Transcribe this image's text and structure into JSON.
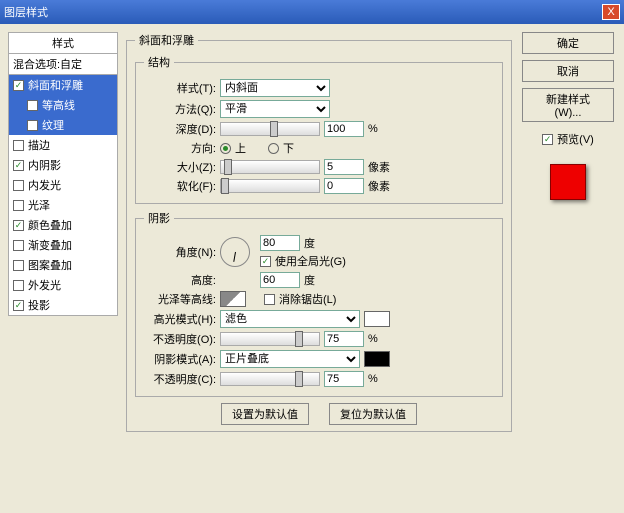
{
  "window": {
    "title": "图层样式",
    "close": "X"
  },
  "left": {
    "header": "样式",
    "sub": "混合选项:自定",
    "items": [
      {
        "label": "斜面和浮雕",
        "checked": true,
        "sel": true
      },
      {
        "label": "等高线",
        "checked": false,
        "sub": true,
        "sel": true
      },
      {
        "label": "纹理",
        "checked": false,
        "sub": true,
        "sel": true
      },
      {
        "label": "描边",
        "checked": false
      },
      {
        "label": "内阴影",
        "checked": true
      },
      {
        "label": "内发光",
        "checked": false
      },
      {
        "label": "光泽",
        "checked": false
      },
      {
        "label": "颜色叠加",
        "checked": true
      },
      {
        "label": "渐变叠加",
        "checked": false
      },
      {
        "label": "图案叠加",
        "checked": false
      },
      {
        "label": "外发光",
        "checked": false
      },
      {
        "label": "投影",
        "checked": true
      }
    ]
  },
  "bevel": {
    "group": "斜面和浮雕",
    "struct": "结构",
    "style_l": "样式(T):",
    "style_v": "内斜面",
    "tech_l": "方法(Q):",
    "tech_v": "平滑",
    "depth_l": "深度(D):",
    "depth_v": "100",
    "pct": "%",
    "dir_l": "方向:",
    "up": "上",
    "down": "下",
    "size_l": "大小(Z):",
    "size_v": "5",
    "px": "像素",
    "soften_l": "软化(F):",
    "soften_v": "0"
  },
  "shade": {
    "group": "阴影",
    "angle_l": "角度(N):",
    "angle_v": "80",
    "deg": "度",
    "global": "使用全局光(G)",
    "alt_l": "高度:",
    "alt_v": "60",
    "gloss_l": "光泽等高线:",
    "aa": "消除锯齿(L)",
    "hmode_l": "高光模式(H):",
    "hmode_v": "滤色",
    "hopac_l": "不透明度(O):",
    "hopac_v": "75",
    "smode_l": "阴影模式(A):",
    "smode_v": "正片叠底",
    "sopac_l": "不透明度(C):",
    "sopac_v": "75"
  },
  "bottom": {
    "def": "设置为默认值",
    "reset": "复位为默认值"
  },
  "right": {
    "ok": "确定",
    "cancel": "取消",
    "newstyle": "新建样式(W)...",
    "preview": "预览(V)"
  }
}
